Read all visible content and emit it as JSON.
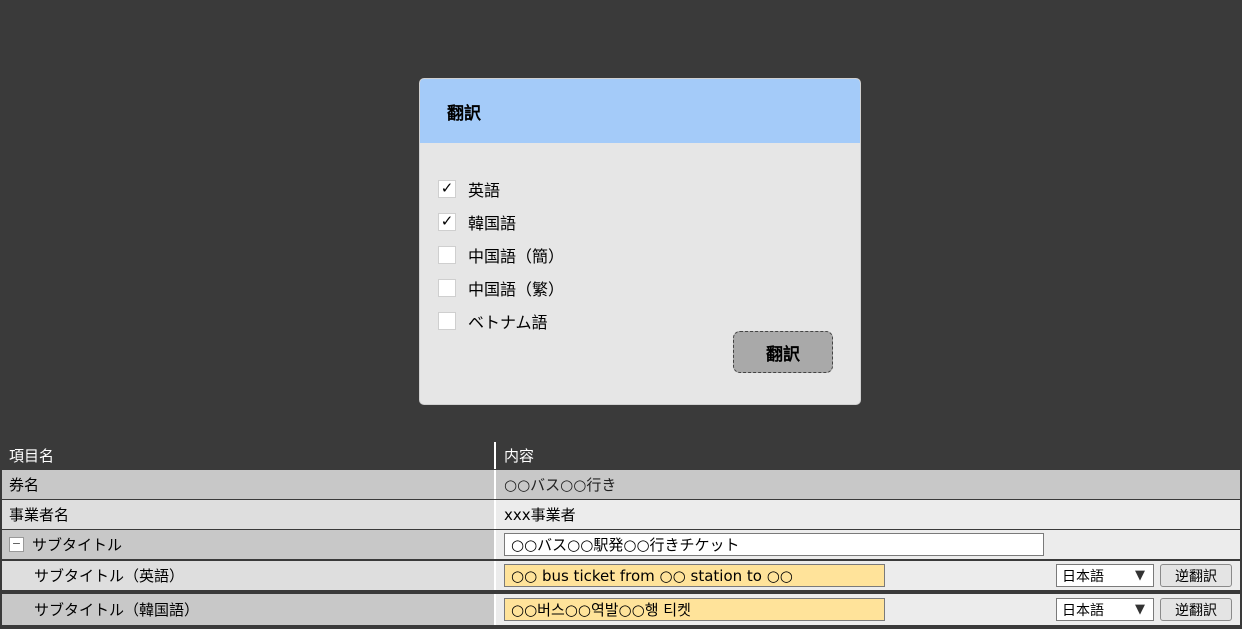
{
  "dialog": {
    "title": "翻訳",
    "options": [
      {
        "label": "英語",
        "checked": true
      },
      {
        "label": "韓国語",
        "checked": true
      },
      {
        "label": "中国語（簡）",
        "checked": false
      },
      {
        "label": "中国語（繁）",
        "checked": false
      },
      {
        "label": "ベトナム語",
        "checked": false
      }
    ],
    "translate_button": "翻訳"
  },
  "table": {
    "headers": {
      "name": "項目名",
      "value": "内容"
    },
    "rows": [
      {
        "name": "券名",
        "value": "○○バス○○行き"
      },
      {
        "name": "事業者名",
        "value": "xxx事業者"
      },
      {
        "name": "サブタイトル",
        "value": "○○バス○○駅発○○行きチケット",
        "collapse_symbol": "−"
      },
      {
        "name": "サブタイトル（英語）",
        "value": "○○ bus ticket from ○○ station to ○○",
        "language": "日本語",
        "reverse_button": "逆翻訳"
      },
      {
        "name": "サブタイトル（韓国語）",
        "value": "○○버스○○역발○○행 티켓",
        "language": "日本語",
        "reverse_button": "逆翻訳"
      }
    ]
  },
  "icons": {
    "check": "✓",
    "dropdown_arrow": "▼"
  },
  "colors": {
    "header_blue": "#a4cbf9",
    "highlight": "#ffe39a",
    "backdrop": "#3a3a3a"
  }
}
